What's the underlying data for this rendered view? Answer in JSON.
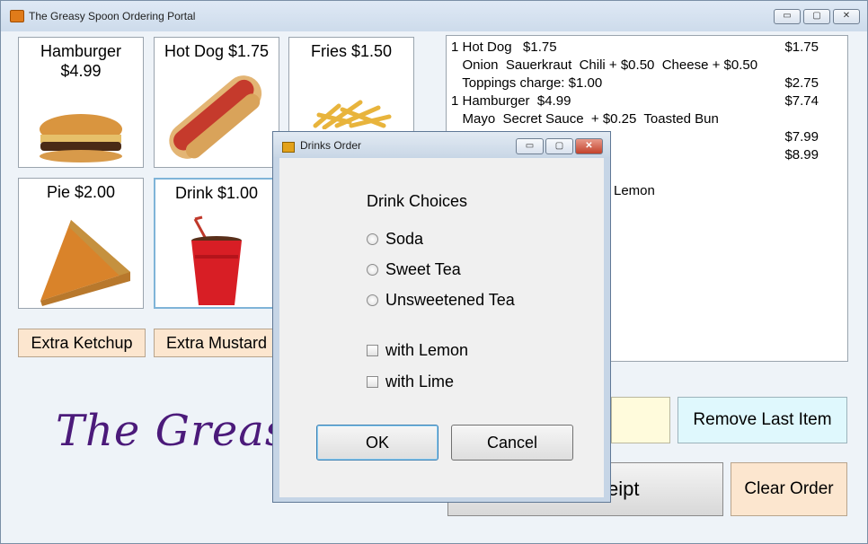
{
  "window": {
    "title": "The Greasy Spoon Ordering Portal",
    "min": "▭",
    "max": "▢",
    "close": "✕"
  },
  "menu": [
    {
      "label_lines": [
        "Hamburger",
        "$4.99"
      ],
      "icon": "hamburger-icon"
    },
    {
      "label_lines": [
        "Hot Dog $1.75"
      ],
      "icon": "hotdog-icon"
    },
    {
      "label_lines": [
        "Fries $1.50"
      ],
      "icon": "fries-icon"
    },
    {
      "label_lines": [
        "Pie $2.00"
      ],
      "icon": "pie-icon"
    },
    {
      "label_lines": [
        "Drink $1.00"
      ],
      "icon": "drink-icon"
    }
  ],
  "extras": {
    "ketchup": "Extra Ketchup",
    "mustard": "Extra Mustard"
  },
  "order_lines": [
    {
      "item": "1 Hot Dog   $1.75",
      "price": "$1.75"
    },
    {
      "item": "   Onion  Sauerkraut  Chili + $0.50  Cheese + $0.50",
      "price": ""
    },
    {
      "item": "   Toppings charge: $1.00",
      "price": "$2.75"
    },
    {
      "item": "1 Hamburger  $4.99",
      "price": "$7.74"
    },
    {
      "item": "   Mayo  Secret Sauce  + $0.25  Toasted Bun",
      "price": ""
    },
    {
      "item": "",
      "price": "$7.99"
    },
    {
      "item": "",
      "price": "$8.99"
    },
    {
      "item": "",
      "price": ""
    },
    {
      "item": "Lemon",
      "price": ""
    }
  ],
  "buttons": {
    "remove_last": "Remove Last Item",
    "receipt_partial": "eipt",
    "clear_order": "Clear Order"
  },
  "logo_text": "The Greasy S",
  "dialog": {
    "title": "Drinks Order",
    "heading": "Drink Choices",
    "options": [
      "Soda",
      "Sweet Tea",
      "Unsweetened Tea"
    ],
    "extras": [
      "with Lemon",
      "with Lime"
    ],
    "ok": "OK",
    "cancel": "Cancel"
  },
  "colors": {
    "accent_extra": "#fce6cf",
    "logo": "#4b1a7a",
    "remove_btn": "#dff8fd",
    "yellow_box": "#fffbdc"
  }
}
